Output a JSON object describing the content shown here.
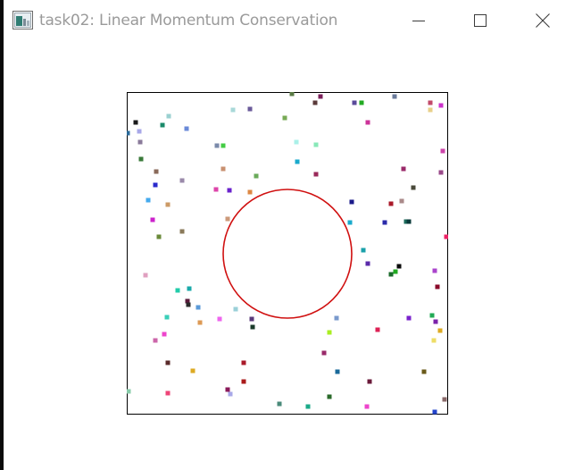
{
  "window": {
    "title": "task02: Linear Momentum Conservation",
    "controls": [
      "minimize",
      "maximize",
      "close"
    ]
  },
  "icons": {
    "app": "window-app-icon",
    "minimize": "minimize-icon",
    "maximize": "maximize-icon",
    "close": "close-icon"
  },
  "colors": {
    "circle": "#d01010",
    "boundary": "#000000",
    "title_text": "#9a9a9a"
  },
  "simulation": {
    "particle_count": 104
  }
}
